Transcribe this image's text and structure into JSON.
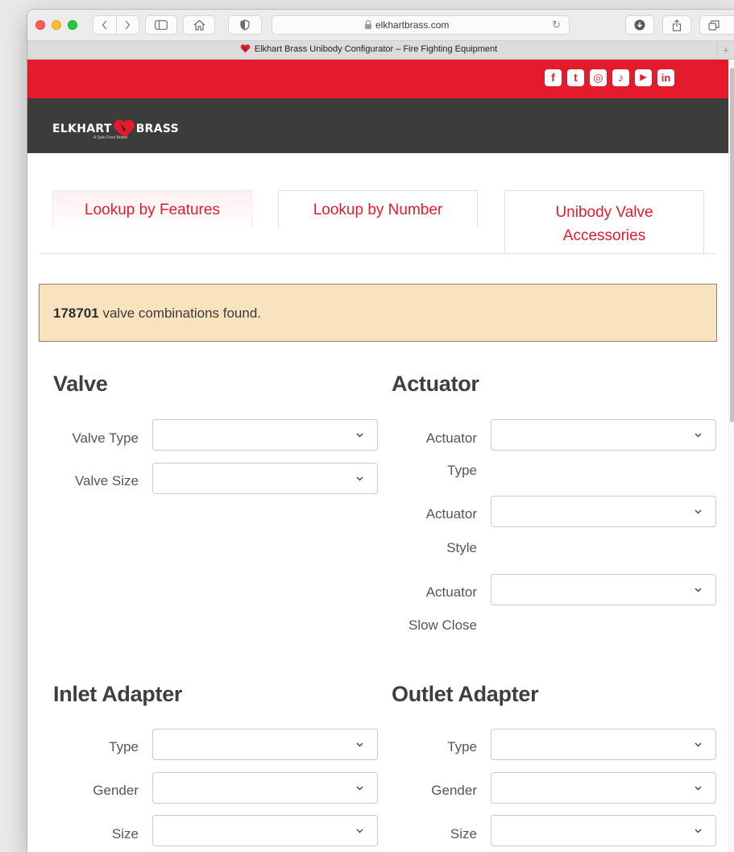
{
  "browser": {
    "url": "elkhartbrass.com",
    "tab_title": "Elkhart Brass Unibody Configurator – Fire Fighting Equipment",
    "new_tab": "+"
  },
  "social": {
    "icons": [
      "facebook-icon",
      "twitter-icon",
      "instagram-icon",
      "tiktok-icon",
      "youtube-icon",
      "linkedin-icon"
    ],
    "glyphs": [
      "f",
      "t",
      "◎",
      "♪",
      "▶",
      "in"
    ]
  },
  "brand": {
    "word_left": "ELKHART",
    "word_right": "BRASS",
    "tagline": "A Safe Fleet Brand",
    "accent": "#e31b2d",
    "header_bg": "#3c3c3b"
  },
  "tabs": [
    {
      "label": "Lookup by Features",
      "active": true
    },
    {
      "label": "Lookup by Number",
      "active": false
    },
    {
      "label": "Unibody Valve Accessories",
      "active": false
    }
  ],
  "notice": {
    "count": "178701",
    "text": " valve combinations found.",
    "bg": "#f9e3bf"
  },
  "sections": {
    "valve": {
      "title": "Valve",
      "fields": [
        {
          "label": "Valve Type",
          "value": ""
        },
        {
          "label": "Valve Size",
          "value": ""
        }
      ]
    },
    "actuator": {
      "title": "Actuator",
      "fields": [
        {
          "label_line1": "Actuator",
          "label_line2": "Type",
          "value": ""
        },
        {
          "label_line1": "Actuator",
          "label_line2": "Style",
          "value": ""
        },
        {
          "label_line1": "Actuator",
          "label_line2": "Slow Close",
          "value": ""
        }
      ]
    },
    "inlet": {
      "title": "Inlet Adapter",
      "fields": [
        {
          "label": "Type",
          "value": ""
        },
        {
          "label": "Gender",
          "value": ""
        },
        {
          "label": "Size",
          "value": ""
        }
      ]
    },
    "outlet": {
      "title": "Outlet Adapter",
      "fields": [
        {
          "label": "Type",
          "value": ""
        },
        {
          "label": "Gender",
          "value": ""
        },
        {
          "label": "Size",
          "value": ""
        }
      ]
    }
  }
}
